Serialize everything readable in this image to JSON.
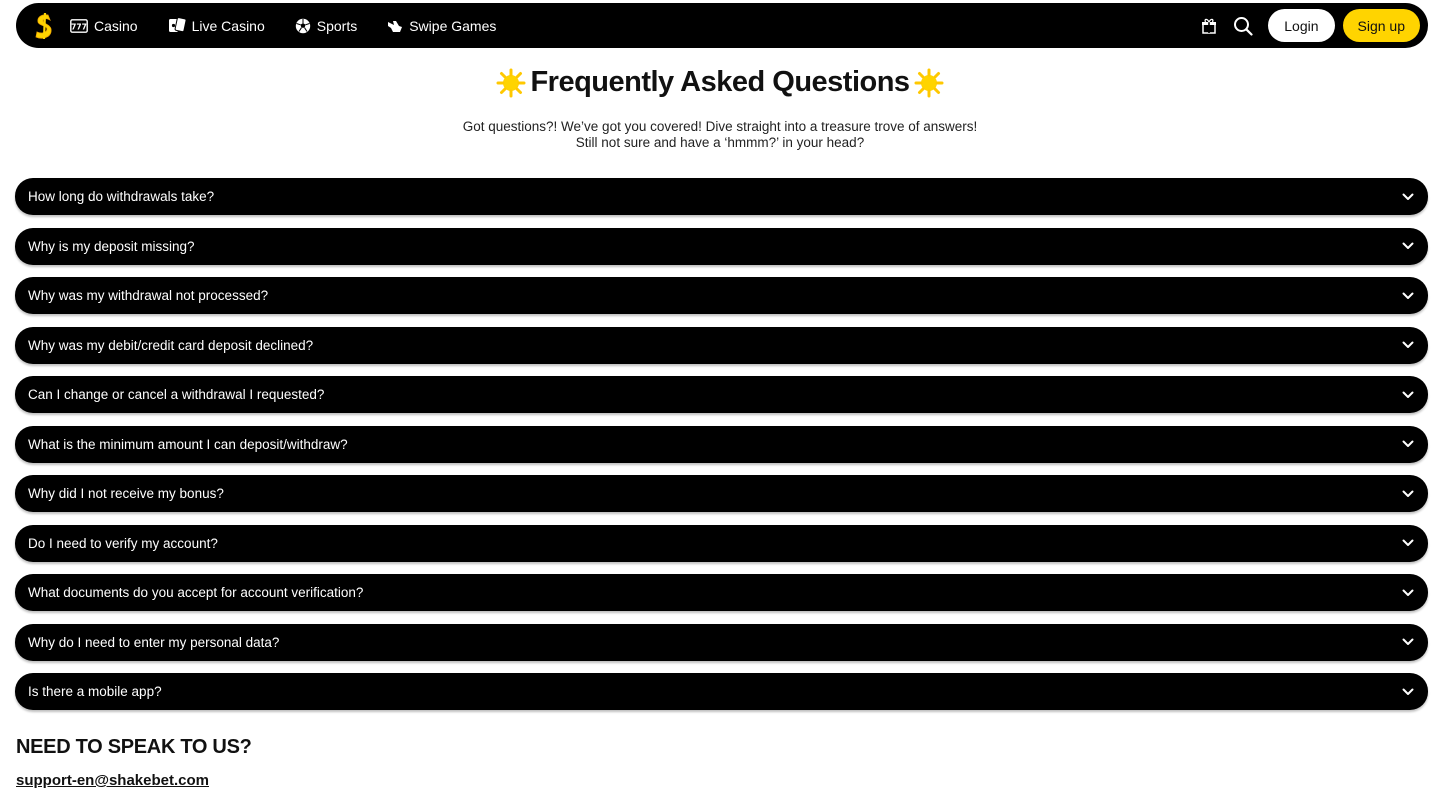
{
  "header": {
    "nav": [
      {
        "label": "Casino",
        "icon": "slot-machine-icon"
      },
      {
        "label": "Live Casino",
        "icon": "cards-icon"
      },
      {
        "label": "Sports",
        "icon": "soccer-ball-icon"
      },
      {
        "label": "Swipe Games",
        "icon": "swipe-hand-icon"
      }
    ],
    "login_label": "Login",
    "signup_label": "Sign up",
    "accent_color": "#ffd400"
  },
  "main": {
    "title": "Frequently Asked Questions",
    "subtitle_line1": "Got questions?! We’ve got you covered! Dive straight into a treasure trove of answers!",
    "subtitle_line2": "Still not sure and have a ‘hmmm?’ in your head?",
    "faq": [
      "How long do withdrawals take?",
      "Why is my deposit missing?",
      "Why was my withdrawal not processed?",
      "Why was my debit/credit card deposit declined?",
      "Can I change or cancel a withdrawal I requested?",
      "What is the minimum amount I can deposit/withdraw?",
      "Why did I not receive my bonus?",
      "Do I need to verify my account?",
      "What documents do you accept for account verification?",
      "Why do I need to enter my personal data?",
      "Is there a mobile app?"
    ]
  },
  "contact": {
    "heading": "NEED TO SPEAK TO US?",
    "email": "support-en@shakebet.com"
  }
}
